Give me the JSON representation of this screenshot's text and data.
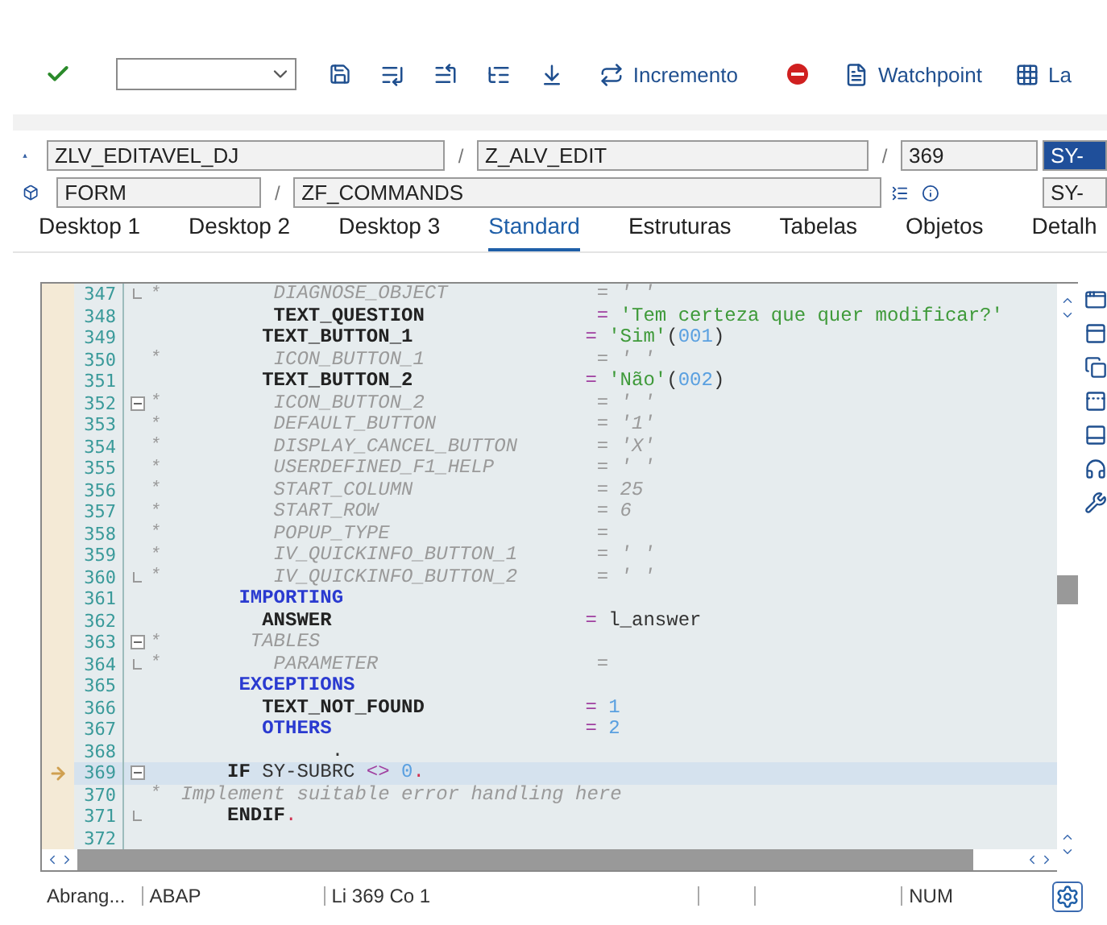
{
  "toolbar": {
    "increment_button": "Incremento",
    "watchpoint_button": "Watchpoint",
    "cut_button": "La"
  },
  "location": {
    "program": "ZLV_EDITAVEL_DJ",
    "include": "Z_ALV_EDIT",
    "line": "369",
    "event_type": "FORM",
    "event": "ZF_COMMANDS",
    "separators": [
      "/",
      "/",
      "/"
    ],
    "variables": [
      {
        "value": "SY-",
        "selected": true
      },
      {
        "value": "SY-",
        "selected": false
      }
    ]
  },
  "tabs": [
    {
      "label": "Desktop 1",
      "selected": false
    },
    {
      "label": "Desktop 2",
      "selected": false
    },
    {
      "label": "Desktop 3",
      "selected": false
    },
    {
      "label": "Standard",
      "selected": true
    },
    {
      "label": "Estruturas",
      "selected": false
    },
    {
      "label": "Tabelas",
      "selected": false
    },
    {
      "label": "Objetos",
      "selected": false
    },
    {
      "label": "Detalh",
      "selected": false
    }
  ],
  "editor": {
    "lines": [
      {
        "number": "347",
        "collapsible": false,
        "block_end": true,
        "current": false,
        "star": "*",
        "tokens": [
          {
            "text": "         DIAGNOSE_OBJECT",
            "kind": "comment"
          }
        ],
        "value": [
          {
            "text": "  = ' '",
            "kind": "comment"
          }
        ]
      },
      {
        "number": "348",
        "collapsible": false,
        "block_end": false,
        "current": false,
        "tokens": [
          {
            "text": "         TEXT_QUESTION",
            "kind": "ident"
          }
        ],
        "value": [
          {
            "text": "  =",
            "kind": "op"
          },
          {
            "text": " 'Tem certeza que quer modificar?'",
            "kind": "string"
          }
        ]
      },
      {
        "number": "349",
        "collapsible": false,
        "block_end": false,
        "current": false,
        "tokens": [
          {
            "text": "        TEXT_BUTTON_1",
            "kind": "ident"
          }
        ],
        "value": [
          {
            "text": " =",
            "kind": "op"
          },
          {
            "text": " 'Sim'",
            "kind": "string"
          },
          {
            "text": "(",
            "kind": "plain"
          },
          {
            "text": "001",
            "kind": "number"
          },
          {
            "text": ")",
            "kind": "plain"
          }
        ]
      },
      {
        "number": "350",
        "collapsible": false,
        "block_end": false,
        "current": false,
        "star": "*",
        "tokens": [
          {
            "text": "         ICON_BUTTON_1",
            "kind": "comment"
          }
        ],
        "value": [
          {
            "text": "  = ' '",
            "kind": "comment"
          }
        ]
      },
      {
        "number": "351",
        "collapsible": false,
        "block_end": false,
        "current": false,
        "tokens": [
          {
            "text": "        TEXT_BUTTON_2",
            "kind": "ident"
          }
        ],
        "value": [
          {
            "text": " =",
            "kind": "op"
          },
          {
            "text": " 'Não'",
            "kind": "string"
          },
          {
            "text": "(",
            "kind": "plain"
          },
          {
            "text": "002",
            "kind": "number"
          },
          {
            "text": ")",
            "kind": "plain"
          }
        ]
      },
      {
        "number": "352",
        "collapsible": true,
        "block_end": false,
        "current": false,
        "star": "*",
        "tokens": [
          {
            "text": "         ICON_BUTTON_2",
            "kind": "comment"
          }
        ],
        "value": [
          {
            "text": "  = ' '",
            "kind": "comment"
          }
        ]
      },
      {
        "number": "353",
        "collapsible": false,
        "block_end": false,
        "current": false,
        "star": "*",
        "tokens": [
          {
            "text": "         DEFAULT_BUTTON",
            "kind": "comment"
          }
        ],
        "value": [
          {
            "text": "  = '1'",
            "kind": "comment"
          }
        ]
      },
      {
        "number": "354",
        "collapsible": false,
        "block_end": false,
        "current": false,
        "star": "*",
        "tokens": [
          {
            "text": "         DISPLAY_CANCEL_BUTTON",
            "kind": "comment"
          }
        ],
        "value": [
          {
            "text": "  = 'X'",
            "kind": "comment"
          }
        ]
      },
      {
        "number": "355",
        "collapsible": false,
        "block_end": false,
        "current": false,
        "star": "*",
        "tokens": [
          {
            "text": "         USERDEFINED_F1_HELP",
            "kind": "comment"
          }
        ],
        "value": [
          {
            "text": "  = ' '",
            "kind": "comment"
          }
        ]
      },
      {
        "number": "356",
        "collapsible": false,
        "block_end": false,
        "current": false,
        "star": "*",
        "tokens": [
          {
            "text": "         START_COLUMN",
            "kind": "comment"
          }
        ],
        "value": [
          {
            "text": "  = 25",
            "kind": "comment"
          }
        ]
      },
      {
        "number": "357",
        "collapsible": false,
        "block_end": false,
        "current": false,
        "star": "*",
        "tokens": [
          {
            "text": "         START_ROW",
            "kind": "comment"
          }
        ],
        "value": [
          {
            "text": "  = 6",
            "kind": "comment"
          }
        ]
      },
      {
        "number": "358",
        "collapsible": false,
        "block_end": false,
        "current": false,
        "star": "*",
        "tokens": [
          {
            "text": "         POPUP_TYPE",
            "kind": "comment"
          }
        ],
        "value": [
          {
            "text": "  =",
            "kind": "comment"
          }
        ]
      },
      {
        "number": "359",
        "collapsible": false,
        "block_end": false,
        "current": false,
        "star": "*",
        "tokens": [
          {
            "text": "         IV_QUICKINFO_BUTTON_1",
            "kind": "comment"
          }
        ],
        "value": [
          {
            "text": "  = ' '",
            "kind": "comment"
          }
        ]
      },
      {
        "number": "360",
        "collapsible": false,
        "block_end": true,
        "current": false,
        "star": "*",
        "tokens": [
          {
            "text": "         IV_QUICKINFO_BUTTON_2",
            "kind": "comment"
          }
        ],
        "value": [
          {
            "text": "  = ' '",
            "kind": "comment"
          }
        ]
      },
      {
        "number": "361",
        "collapsible": false,
        "block_end": false,
        "current": false,
        "tokens": [
          {
            "text": "      IMPORTING",
            "kind": "keyword"
          }
        ]
      },
      {
        "number": "362",
        "collapsible": false,
        "block_end": false,
        "current": false,
        "tokens": [
          {
            "text": "        ANSWER",
            "kind": "ident"
          }
        ],
        "value": [
          {
            "text": " =",
            "kind": "op"
          },
          {
            "text": " l_answer",
            "kind": "plain"
          }
        ]
      },
      {
        "number": "363",
        "collapsible": true,
        "block_end": false,
        "current": false,
        "star": "*",
        "tokens": [
          {
            "text": "       TABLES",
            "kind": "comment"
          }
        ]
      },
      {
        "number": "364",
        "collapsible": false,
        "block_end": true,
        "current": false,
        "star": "*",
        "tokens": [
          {
            "text": "         PARAMETER",
            "kind": "comment"
          }
        ],
        "value": [
          {
            "text": "  =",
            "kind": "comment"
          }
        ]
      },
      {
        "number": "365",
        "collapsible": false,
        "block_end": false,
        "current": false,
        "tokens": [
          {
            "text": "      EXCEPTIONS",
            "kind": "keyword"
          }
        ]
      },
      {
        "number": "366",
        "collapsible": false,
        "block_end": false,
        "current": false,
        "tokens": [
          {
            "text": "        TEXT_NOT_FOUND",
            "kind": "ident"
          }
        ],
        "value": [
          {
            "text": " =",
            "kind": "op"
          },
          {
            "text": " 1",
            "kind": "number"
          }
        ]
      },
      {
        "number": "367",
        "collapsible": false,
        "block_end": false,
        "current": false,
        "tokens": [
          {
            "text": "        OTHERS",
            "kind": "keyword"
          }
        ],
        "value": [
          {
            "text": " =",
            "kind": "op"
          },
          {
            "text": " 2",
            "kind": "number"
          }
        ]
      },
      {
        "number": "368",
        "collapsible": false,
        "block_end": false,
        "current": false,
        "tokens": [
          {
            "text": "              .",
            "kind": "plain"
          }
        ]
      },
      {
        "number": "369",
        "collapsible": true,
        "block_end": false,
        "current": true,
        "tokens": [
          {
            "text": "     IF",
            "kind": "ident"
          },
          {
            "text": " SY-SUBRC",
            "kind": "plain"
          },
          {
            "text": " <>",
            "kind": "op"
          },
          {
            "text": " 0",
            "kind": "number"
          },
          {
            "text": ".",
            "kind": "period"
          }
        ]
      },
      {
        "number": "370",
        "collapsible": false,
        "block_end": false,
        "current": false,
        "star": "*",
        "tokens": [
          {
            "text": " Implement suitable error handling here",
            "kind": "comment"
          }
        ]
      },
      {
        "number": "371",
        "collapsible": false,
        "block_end": true,
        "current": false,
        "tokens": [
          {
            "text": "     ENDIF",
            "kind": "ident"
          },
          {
            "text": ".",
            "kind": "period"
          }
        ]
      },
      {
        "number": "372",
        "collapsible": false,
        "block_end": false,
        "current": false
      }
    ]
  },
  "status_bar": {
    "scope": "Abrang...",
    "language": "ABAP",
    "position": "Li 369 Co  1",
    "mode": "NUM"
  }
}
